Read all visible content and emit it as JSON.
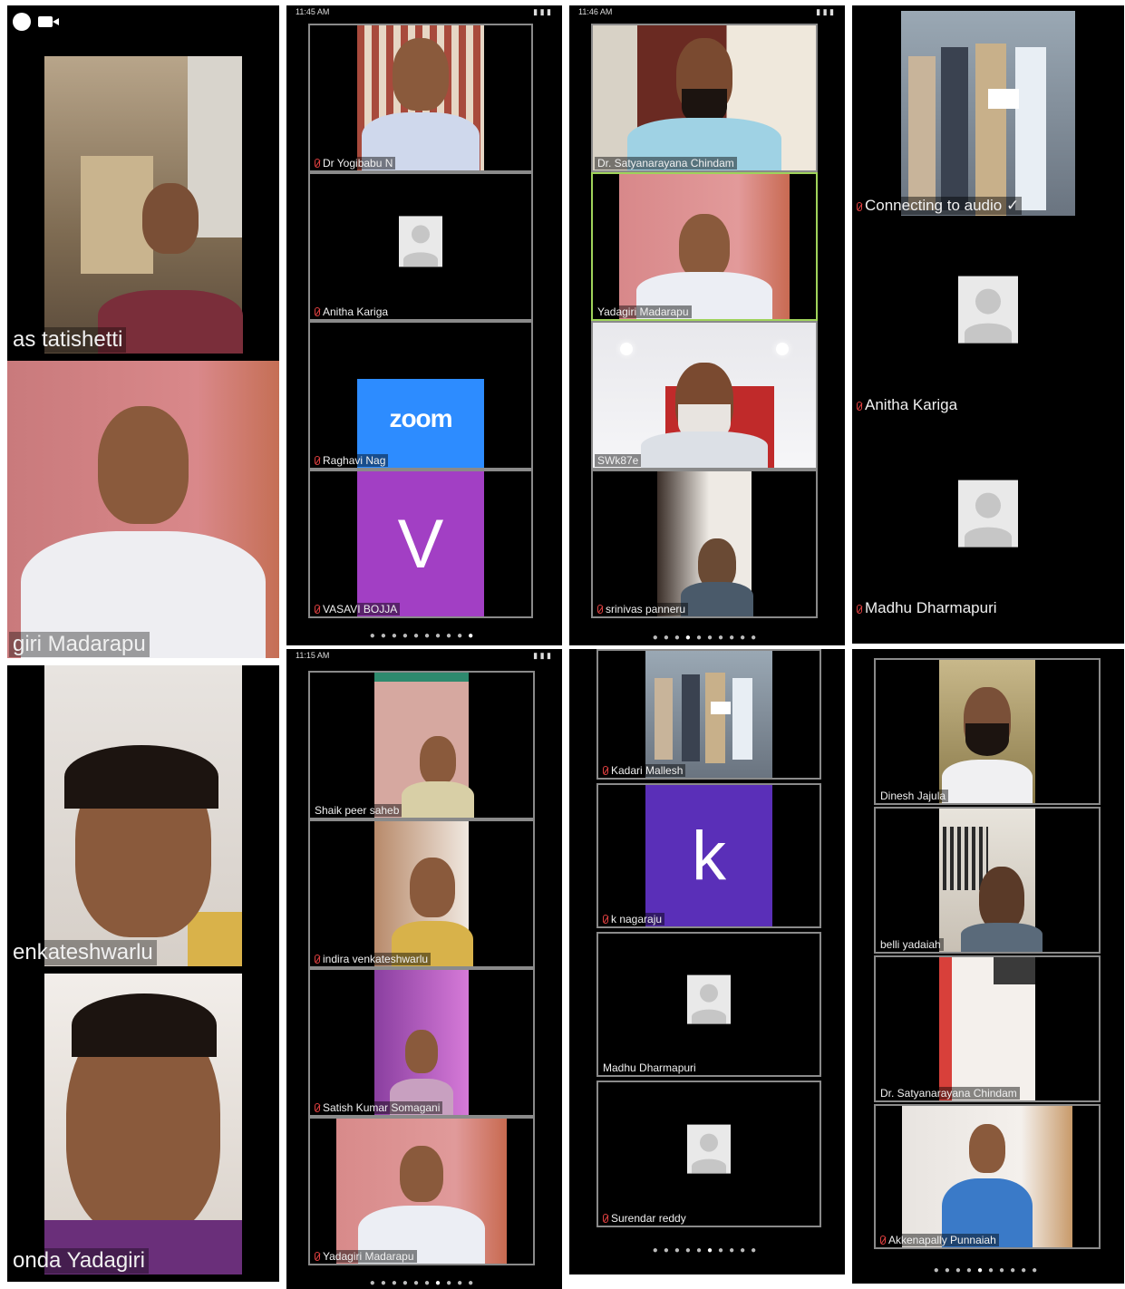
{
  "phone_status": {
    "p2_time": "11:45 AM",
    "p3_time": "11:46 AM",
    "p6_time": "11:15 AM"
  },
  "panel1": {
    "tiles": [
      {
        "name": "as tatishetti"
      },
      {
        "name": "giri Madarapu"
      },
      {
        "name": "enkateshwarlu"
      },
      {
        "name": "onda Yadagiri"
      }
    ]
  },
  "panel2": {
    "tiles": [
      {
        "name": "Dr Yogibabu N"
      },
      {
        "name": "Anitha Kariga"
      },
      {
        "name": "Raghavi Nag",
        "logo": "zoom"
      },
      {
        "name": "VASAVI BOJJA",
        "letter": "V"
      }
    ]
  },
  "panel3": {
    "tiles": [
      {
        "name": "Dr. Satyanarayana Chindam"
      },
      {
        "name": "Yadagiri Madarapu"
      },
      {
        "name": "SWk87e"
      },
      {
        "name": "srinivas panneru"
      }
    ]
  },
  "panel4": {
    "tiles": [
      {
        "name": "Connecting to audio ✓"
      },
      {
        "name": "Anitha Kariga"
      },
      {
        "name": "Madhu Dharmapuri"
      }
    ]
  },
  "panel6": {
    "tiles": [
      {
        "name": "Shaik peer saheb"
      },
      {
        "name": "indira venkateshwarlu"
      },
      {
        "name": "Satish Kumar Somagani"
      },
      {
        "name": "Yadagiri Madarapu"
      }
    ]
  },
  "panel7": {
    "tiles": [
      {
        "name": "Kadari Mallesh"
      },
      {
        "name": "k nagaraju",
        "letter": "k"
      },
      {
        "name": "Madhu Dharmapuri"
      },
      {
        "name": "Surendar reddy"
      }
    ]
  },
  "panel8": {
    "tiles": [
      {
        "name": "Dinesh Jajula"
      },
      {
        "name": "belli yadaiah"
      },
      {
        "name": "Dr. Satyanarayana Chindam"
      },
      {
        "name": "Akkenapally Punnaiah"
      }
    ]
  },
  "colors": {
    "zoom_blue": "#2d8cff",
    "vasavi_purple": "#a23fc4",
    "k_purple": "#5a2fb8",
    "active_speaker": "#9fd35a"
  }
}
